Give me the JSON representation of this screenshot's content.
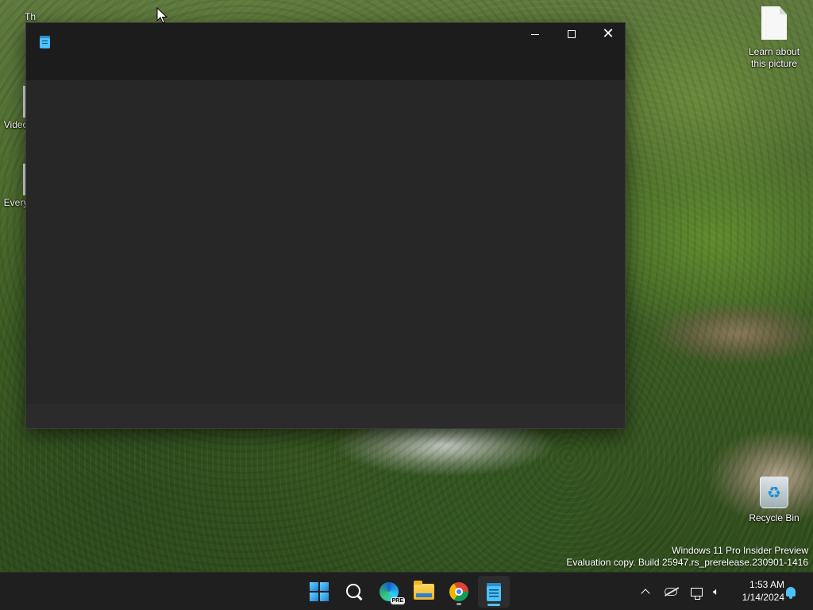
{
  "desktop": {
    "icons": [
      {
        "label": "Th",
        "kind": "folder"
      },
      {
        "label": "Video",
        "kind": "file"
      },
      {
        "label": "Every",
        "kind": "file"
      },
      {
        "label": "Learn about this picture",
        "kind": "document"
      },
      {
        "label": "Recycle Bin",
        "kind": "recycle-bin"
      }
    ],
    "watermark": {
      "line1": "Windows 11 Pro Insider Preview",
      "line2": "Evaluation copy. Build 25947.rs_prerelease.230901-1416"
    }
  },
  "window": {
    "app": "Notepad",
    "app_icon": "notepad-icon",
    "title": "",
    "content": "",
    "controls": {
      "minimize_icon": "minimize-icon",
      "maximize_icon": "maximize-icon",
      "close_glyph": "✕"
    }
  },
  "taskbar": {
    "apps": [
      {
        "name": "Start",
        "icon": "windows-logo-icon"
      },
      {
        "name": "Search",
        "icon": "search-icon"
      },
      {
        "name": "Microsoft Edge Preview",
        "icon": "edge-icon",
        "badge": "PRE"
      },
      {
        "name": "File Explorer",
        "icon": "folder-icon"
      },
      {
        "name": "Google Chrome",
        "icon": "chrome-icon",
        "running": true
      },
      {
        "name": "Notepad",
        "icon": "notepad-icon",
        "active": true
      }
    ],
    "tray": {
      "icons": [
        "chevron-up-icon",
        "onedrive-offline-icon",
        "network-icon",
        "speaker-muted-icon"
      ],
      "time": "1:53 AM",
      "date": "1/14/2024",
      "notification_icon": "bell-icon"
    }
  },
  "colors": {
    "window_bg": "#202020",
    "titlebar_bg": "#1c1c1c",
    "taskbar_bg": "#1f1f1f",
    "accent": "#4cc2ff"
  }
}
